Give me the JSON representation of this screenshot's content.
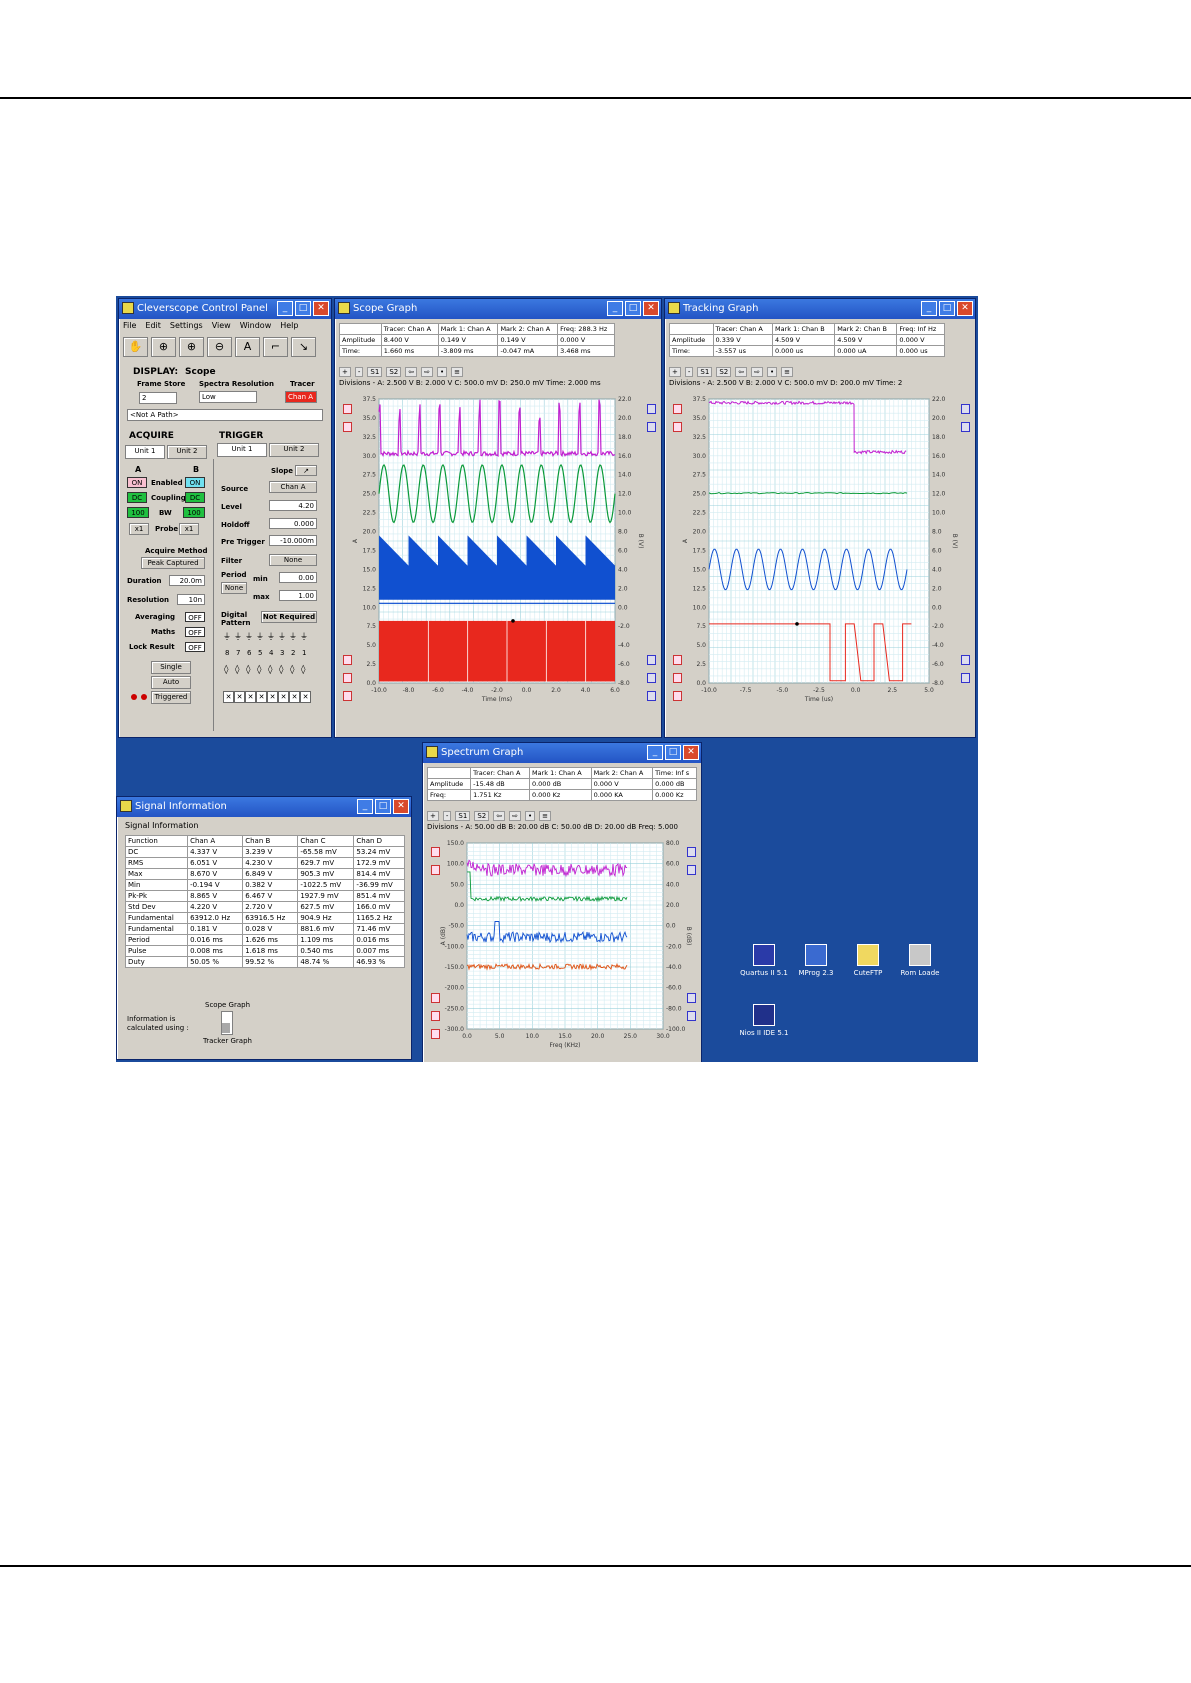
{
  "colors": {
    "magenta": "#c020d0",
    "green": "#0a9a3a",
    "blue": "#1050d0",
    "red": "#e8281e",
    "orange": "#e05010",
    "desktop": "#1b4b9c"
  },
  "control_panel": {
    "title": "Cleverscope Control Panel",
    "menu": [
      "File",
      "Edit",
      "Settings",
      "View",
      "Window",
      "Help"
    ],
    "tools": [
      "hand-icon",
      "zoom-icon",
      "zoom-in-icon",
      "zoom-out-icon",
      "text-icon",
      "cursor-icon",
      "pointer-icon"
    ],
    "display_label": "DISPLAY:",
    "display_value": "Scope",
    "frame_store_label": "Frame Store",
    "frame_store_value": "2",
    "spectra_label": "Spectra Resolution",
    "spectra_value": "Low",
    "tracer_label": "Tracer",
    "tracer_value": "Chan A",
    "path_value": "<Not A Path>",
    "acquire_label": "ACQUIRE",
    "trigger_label": "TRIGGER",
    "acq_tabs": [
      "Unit 1",
      "Unit 2"
    ],
    "trig_tabs": [
      "Unit 1",
      "Unit 2"
    ],
    "col_a": "A",
    "col_b": "B",
    "enabled_label": "Enabled",
    "coupling_label": "Coupling",
    "bw_label": "BW",
    "probe_label": "Probe",
    "a_enabled": "ON",
    "b_enabled": "ON",
    "a_coupling": "DC",
    "b_coupling": "DC",
    "a_bw": "100",
    "b_bw": "100",
    "a_probe": "x1",
    "b_probe": "x1",
    "acquire_method_label": "Acquire Method",
    "acquire_method_value": "Peak Captured",
    "duration_label": "Duration",
    "duration_value": "20.0m",
    "resolution_label": "Resolution",
    "resolution_value": "10n",
    "averaging_label": "Averaging",
    "averaging_value": "OFF",
    "maths_label": "Maths",
    "maths_value": "OFF",
    "lock_label": "Lock Result",
    "lock_value": "OFF",
    "single_label": "Single",
    "auto_label": "Auto",
    "triggered_label": "Triggered",
    "slope_label": "Slope",
    "source_label": "Source",
    "source_value": "Chan A",
    "level_label": "Level",
    "level_value": "4.20",
    "holdoff_label": "Holdoff",
    "holdoff_value": "0.000",
    "pretrigger_label": "Pre Trigger",
    "pretrigger_value": "-10.000m",
    "filter_label": "Filter",
    "filter_value": "None",
    "period_label": "Period",
    "period_value": "None",
    "min_label": "min",
    "min_value": "0.00",
    "max_label": "max",
    "max_value": "1.00",
    "digital_label": "Digital Pattern",
    "digital_value": "Not Required",
    "bits": [
      "8",
      "7",
      "6",
      "5",
      "4",
      "3",
      "2",
      "1"
    ]
  },
  "scope_graph": {
    "title": "Scope Graph",
    "table": {
      "headers": [
        "",
        "Tracer: Chan A",
        "Mark 1: Chan A",
        "Mark 2: Chan A",
        "Freq: 288.3 Hz"
      ],
      "rows": [
        [
          "Amplitude",
          "8.400 V",
          "0.149 V",
          "0.149 V",
          "0.000 V"
        ],
        [
          "Time:",
          "1.660 ms",
          "-3.809 ms",
          "-0.047 mA",
          "3.468 ms"
        ]
      ]
    },
    "divisions": "Divisions -  A: 2.500 V   B: 2.000 V   C: 500.0 mV   D: 250.0 mV   Time: 2.000 ms",
    "toolbar": [
      "+",
      "-",
      "S1",
      "S2",
      "⇦",
      "⇨",
      "•",
      "≡"
    ],
    "left_ticks": [
      "37.5",
      "35.0",
      "32.5",
      "30.0",
      "27.5",
      "25.0",
      "22.5",
      "20.0",
      "17.5",
      "15.0",
      "12.5",
      "10.0",
      "7.5",
      "5.0",
      "2.5",
      "0.0"
    ],
    "right_ticks": [
      "22.0",
      "20.0",
      "18.0",
      "16.0",
      "14.0",
      "12.0",
      "10.0",
      "8.0",
      "6.0",
      "4.0",
      "2.0",
      "0.0",
      "-2.0",
      "-4.0",
      "-6.0",
      "-8.0"
    ],
    "x_ticks": [
      "-10.0",
      "-8.0",
      "-6.0",
      "-4.0",
      "-2.0",
      "0.0",
      "2.0",
      "4.0",
      "6.0"
    ],
    "xlabel": "Time (ms)",
    "ylabel_left": "A",
    "ylabel_right": "B (V)"
  },
  "tracking_graph": {
    "title": "Tracking Graph",
    "table": {
      "headers": [
        "",
        "Tracer: Chan A",
        "Mark 1: Chan B",
        "Mark 2: Chan B",
        "Freq: Inf Hz"
      ],
      "rows": [
        [
          "Amplitude",
          "0.339 V",
          "4.509 V",
          "4.509 V",
          "0.000 V"
        ],
        [
          "Time:",
          "-3.557 us",
          "0.000 us",
          "0.000 uA",
          "0.000 us"
        ]
      ]
    },
    "divisions": "Divisions -  A: 2.500 V   B: 2.000 V   C: 500.0 mV   D: 200.0 mV   Time: 2",
    "toolbar": [
      "+",
      "-",
      "S1",
      "S2",
      "⇦",
      "⇨",
      "•",
      "≡"
    ],
    "left_ticks": [
      "37.5",
      "35.0",
      "32.5",
      "30.0",
      "27.5",
      "25.0",
      "22.5",
      "20.0",
      "17.5",
      "15.0",
      "12.5",
      "10.0",
      "7.5",
      "5.0",
      "2.5",
      "0.0"
    ],
    "right_ticks": [
      "22.0",
      "20.0",
      "18.0",
      "16.0",
      "14.0",
      "12.0",
      "10.0",
      "8.0",
      "6.0",
      "4.0",
      "2.0",
      "0.0",
      "-2.0",
      "-4.0",
      "-6.0",
      "-8.0"
    ],
    "x_ticks": [
      "-10.0",
      "-7.5",
      "-5.0",
      "-2.5",
      "0.0",
      "2.5",
      "5.0"
    ],
    "xlabel": "Time (us)",
    "ylabel_left": "A",
    "ylabel_right": "B (V)"
  },
  "spectrum_graph": {
    "title": "Spectrum Graph",
    "table": {
      "headers": [
        "",
        "Tracer: Chan A",
        "Mark 1: Chan A",
        "Mark 2: Chan A",
        "Time: Inf s"
      ],
      "rows": [
        [
          "Amplitude",
          "-15.48 dB",
          "0.000 dB",
          "0.000 V",
          "0.000 dB"
        ],
        [
          "Freq:",
          "1.751 Kz",
          "0.000 Kz",
          "0.000 KA",
          "0.000 Kz"
        ]
      ]
    },
    "divisions": "Divisions -  A: 50.00 dB   B: 20.00 dB   C: 50.00 dB   D: 20.00 dB   Freq: 5.000",
    "toolbar": [
      "+",
      "-",
      "S1",
      "S2",
      "⇦",
      "⇨",
      "•",
      "≡"
    ],
    "left_ticks": [
      "150.0",
      "100.0",
      "50.0",
      "0.0",
      "-50.0",
      "-100.0",
      "-150.0",
      "-200.0",
      "-250.0",
      "-300.0"
    ],
    "right_ticks": [
      "80.0",
      "60.0",
      "40.0",
      "20.0",
      "0.0",
      "-20.0",
      "-40.0",
      "-60.0",
      "-80.0",
      "-100.0"
    ],
    "x_ticks": [
      "0.0",
      "5.0",
      "10.0",
      "15.0",
      "20.0",
      "25.0",
      "30.0"
    ],
    "xlabel": "Freq (KHz)",
    "ylabel_left": "A (dB)",
    "ylabel_right": "B (dB)"
  },
  "signal_info": {
    "title": "Signal Information",
    "subtitle": "Signal Information",
    "headers": [
      "Function",
      "Chan A",
      "Chan B",
      "Chan C",
      "Chan D"
    ],
    "rows": [
      [
        "DC",
        "4.337 V",
        "3.239 V",
        "-65.58 mV",
        "53.24 mV"
      ],
      [
        "RMS",
        "6.051 V",
        "4.230 V",
        "629.7 mV",
        "172.9 mV"
      ],
      [
        "Max",
        "8.670 V",
        "6.849 V",
        "905.3 mV",
        "814.4 mV"
      ],
      [
        "Min",
        "-0.194 V",
        "0.382 V",
        "-1022.5 mV",
        "-36.99 mV"
      ],
      [
        "Pk-Pk",
        "8.865 V",
        "6.467 V",
        "1927.9 mV",
        "851.4 mV"
      ],
      [
        "Std Dev",
        "4.220 V",
        "2.720 V",
        "627.5 mV",
        "166.0 mV"
      ],
      [
        "Fundamental",
        "63912.0 Hz",
        "63916.5 Hz",
        "904.9 Hz",
        "1165.2 Hz"
      ],
      [
        "Fundamental",
        "0.181 V",
        "0.028 V",
        "881.6 mV",
        "71.46 mV"
      ],
      [
        "Period",
        "0.016 ms",
        "1.626 ms",
        "1.109 ms",
        "0.016 ms"
      ],
      [
        "Pulse",
        "0.008 ms",
        "1.618 ms",
        "0.540 ms",
        "0.007 ms"
      ],
      [
        "Duty",
        "50.05 %",
        "99.52 %",
        "48.74 %",
        "46.93 %"
      ]
    ],
    "calc_label": "Information is calculated using :",
    "opt_scope": "Scope Graph",
    "opt_tracker": "Tracker Graph"
  },
  "desktop_icons": [
    {
      "label": "Quartus II 5.1",
      "icon": "quartus-icon"
    },
    {
      "label": "MProg 2.3",
      "icon": "mprog-icon"
    },
    {
      "label": "CuteFTP",
      "icon": "folder-icon"
    },
    {
      "label": "Rom Loade",
      "icon": "rom-icon"
    },
    {
      "label": "Nios II IDE 5.1",
      "icon": "nios-icon"
    }
  ]
}
